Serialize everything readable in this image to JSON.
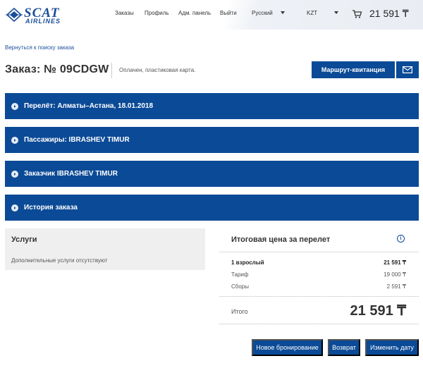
{
  "header": {
    "logo": {
      "brand": "SCAT",
      "sub": "AIRLINES"
    },
    "nav": [
      "Заказы",
      "Профиль",
      "Адм. панель",
      "Выйти"
    ],
    "language": "Русский",
    "currency": "KZT",
    "cart_total": "21 591 ₸"
  },
  "page": {
    "back_link": "Вернуться к поиску заказа",
    "order_title": "Заказ: № 09CDGW",
    "payment_status": "Оплачен, пластиковая карта.",
    "receipt_button": "Маршрут-квитанция"
  },
  "sections": [
    {
      "label": "Перелёт: Алматы–Астана, 18.01.2018"
    },
    {
      "label": "Пассажиры: IBRASHEV TIMUR"
    },
    {
      "label": "Заказчик IBRASHEV TIMUR"
    },
    {
      "label": "История заказа"
    }
  ],
  "services": {
    "title": "Услуги",
    "empty_text": "Дополнительные услуги отсутствуют"
  },
  "price": {
    "title": "Итоговая цена за перелет",
    "info_icon": "i",
    "rows": [
      {
        "label": "1 взрослый",
        "value": "21 591 ₸"
      },
      {
        "label": "Тариф",
        "value": "19 000 ₸"
      },
      {
        "label": "Сборы",
        "value": "2 591 ₸"
      }
    ],
    "total_label": "Итого",
    "total_value": "21 591 ₸"
  },
  "actions": {
    "new_booking": "Новое бронирование",
    "refund": "Возврат",
    "change_date": "Изменить дату"
  },
  "colors": {
    "primary": "#0b4a96",
    "brand": "#1b4e9b",
    "panel": "#efefef"
  },
  "icons": {
    "logo": "scat-logo-icon",
    "cart": "cart-icon",
    "mail": "envelope-icon",
    "chevron": "chevron-right-icon",
    "info": "info-icon"
  }
}
